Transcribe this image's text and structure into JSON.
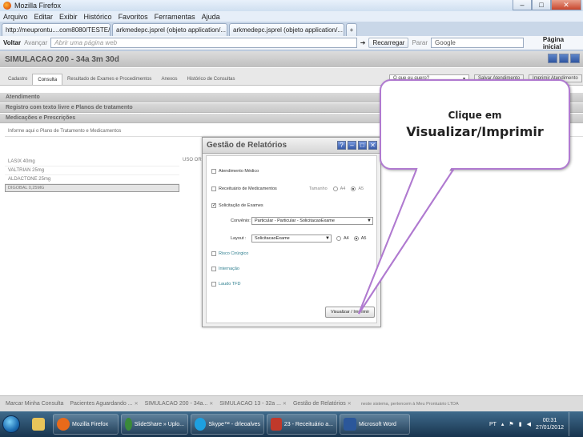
{
  "window": {
    "title": "Mozilla Firefox"
  },
  "menu": [
    "Arquivo",
    "Editar",
    "Exibir",
    "Histórico",
    "Favoritos",
    "Ferramentas",
    "Ajuda"
  ],
  "browser_tabs": [
    {
      "label": "http://meuprontu....com8080/TESTE/#"
    },
    {
      "label": "arkmedepc.jsprel (objeto application/..."
    },
    {
      "label": "arkmedepc.jsprel (objeto application/..."
    }
  ],
  "nav": {
    "back": "Voltar",
    "forward": "Avançar",
    "url_placeholder": "Abrir uma página web",
    "reload": "Recarregar",
    "stop": "Parar",
    "search": "Google",
    "home": "Página inicial"
  },
  "app": {
    "title": "SIMULACAO 200 - 34a 3m 30d",
    "subtabs": [
      "Cadastro",
      "Consulta",
      "Resultado de Exames e Procedimentos",
      "Anexos",
      "Histórico de Consultas"
    ],
    "active_subtab": "Consulta",
    "question_placeholder": "O que eu quero?",
    "save_button": "Salvar Atendimento",
    "print_button": "Imprimir Atendimento",
    "sections": [
      "Atendimento",
      "Registro com texto livre e Planos de tratamento",
      "Medicações e Prescrições"
    ],
    "plano_label": "Informe aqui o Plano de Tratamento e  Medicamentos",
    "meds": [
      "LASIX 40mg",
      "VALTRIAN 25mg",
      "ALDACTONE 25mg",
      "DIGOBAL 0,25MG"
    ],
    "uso_label": "USO OR"
  },
  "modal": {
    "title": "Gestão de Relatórios",
    "options": [
      {
        "label": "Atendimento Médico",
        "checked": false
      },
      {
        "label": "Receituário de Medicamentos",
        "checked": false
      },
      {
        "label": "Solicitação de Exames",
        "checked": true
      }
    ],
    "tamanho_label": "Tamanho",
    "a4": "A4",
    "a5": "A5",
    "convenio_label": "Convênio:",
    "convenio_value": "Particular - Particular - SolicitacaoExame",
    "layout_label": "Layout :",
    "layout_value": "SolicitacaoExame",
    "extra_options": [
      "Risco Cirúrgico",
      "Internação",
      "Laudo TFD"
    ],
    "print_button": "Visualizar / Imprimir"
  },
  "callout": {
    "line1": "Clique em",
    "line2": "Visualizar/Imprimir"
  },
  "bottom_tabs": [
    "Marcar Minha Consulta",
    "Pacientes Aguardando ...",
    "SIMULACAO 200 - 34a...",
    "SIMULACAO 13 - 32a ...",
    "Gestão de Relatórios"
  ],
  "bottom_note": "neste sistema, pertencem à Meu Prontuário LTDA",
  "taskbar": {
    "items": [
      "Mozilla Firefox",
      "SlideShare » Uplo...",
      "Skype™ - drleoalves",
      "23 - Receituário a...",
      "Microsoft Word"
    ],
    "lang": "PT",
    "time": "00:31",
    "date": "27/01/2012",
    "colors": {
      "firefox": "#e86a1a",
      "chrome": "#3a8a3a",
      "skype": "#1ea0e0",
      "slides": "#c0392b",
      "word": "#2b579a"
    }
  }
}
